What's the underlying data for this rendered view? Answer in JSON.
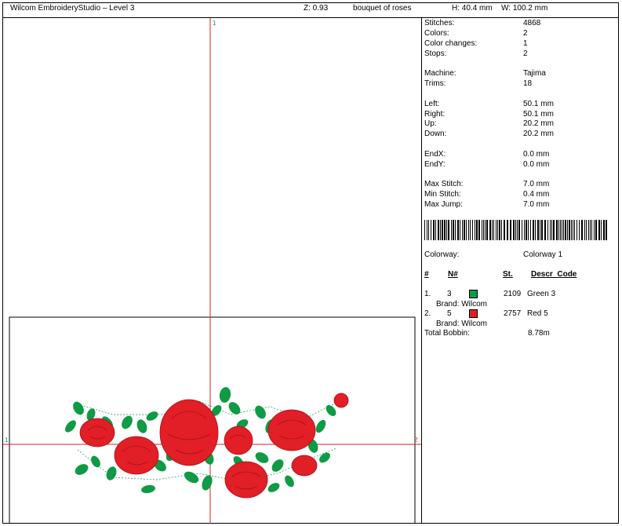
{
  "header": {
    "app_title": "Wilcom EmbroideryStudio – Level 3",
    "zoom": "Z: 0.93",
    "design_name": "bouquet of roses",
    "height": "H: 40.4 mm",
    "width": "W: 100.2 mm"
  },
  "canvas": {
    "top_marker": "1",
    "left_marker": "1",
    "right_marker": "2"
  },
  "stats": [
    {
      "label": "Stitches:",
      "value": "4868"
    },
    {
      "label": "Colors:",
      "value": "2"
    },
    {
      "label": "Color changes:",
      "value": "1"
    },
    {
      "label": "Stops:",
      "value": "2"
    },
    {
      "label": "Machine:",
      "value": "Tajima"
    },
    {
      "label": "Trims:",
      "value": "18"
    },
    {
      "label": "Left:",
      "value": "50.1 mm"
    },
    {
      "label": "Right:",
      "value": "50.1 mm"
    },
    {
      "label": "Up:",
      "value": "20.2 mm"
    },
    {
      "label": "Down:",
      "value": "20.2 mm"
    },
    {
      "label": "EndX:",
      "value": "0.0 mm"
    },
    {
      "label": "EndY:",
      "value": "0.0 mm"
    },
    {
      "label": "Max Stitch:",
      "value": "7.0 mm"
    },
    {
      "label": "Min Stitch:",
      "value": "0.4 mm"
    },
    {
      "label": "Max Jump:",
      "value": "7.0 mm"
    }
  ],
  "colorway": {
    "label": "Colorway:",
    "value": "Colorway 1"
  },
  "thread_table": {
    "headers": {
      "index": "#",
      "needle": "N#",
      "stitches": "St.",
      "descr": "Descr_Code"
    },
    "rows": [
      {
        "index": "1.",
        "needle": "3",
        "color": "#0f9a46",
        "stitches": "2109",
        "descr": "Green 3",
        "brand": "Brand: Wilcom"
      },
      {
        "index": "2.",
        "needle": "5",
        "color": "#e21e26",
        "stitches": "2757",
        "descr": "Red 5",
        "brand": "Brand: Wilcom"
      }
    ]
  },
  "bobbin": {
    "label": "Total Bobbin:",
    "value": "8.78m"
  },
  "colors": {
    "red": "#e21e26",
    "green": "#0f9a46",
    "axis": "#e21e26"
  }
}
